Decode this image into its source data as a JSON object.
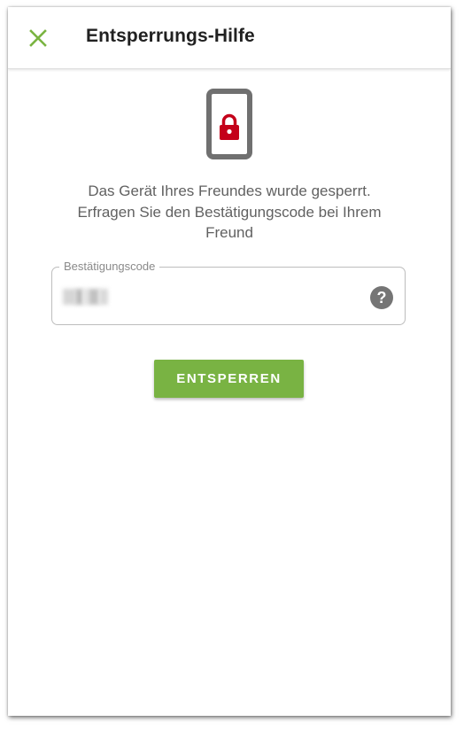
{
  "app_bar": {
    "title": "Entsperrungs-Hilfe",
    "close_icon": "close-icon",
    "accent_color": "#7ab441"
  },
  "illustration": {
    "icon": "locked-phone-icon",
    "phone_color": "#707070",
    "lock_color": "#c4001a"
  },
  "message": {
    "line1": "Das Gerät Ihres Freundes wurde gesperrt.",
    "line2": "Erfragen Sie den Bestätigungscode bei Ihrem",
    "line3": "Freund"
  },
  "code_field": {
    "label": "Bestätigungscode",
    "value_obscured": true,
    "help_icon": "help-circle-icon",
    "help_glyph": "?"
  },
  "unlock_button": {
    "label": "ENTSPERREN",
    "color": "#79b343"
  }
}
